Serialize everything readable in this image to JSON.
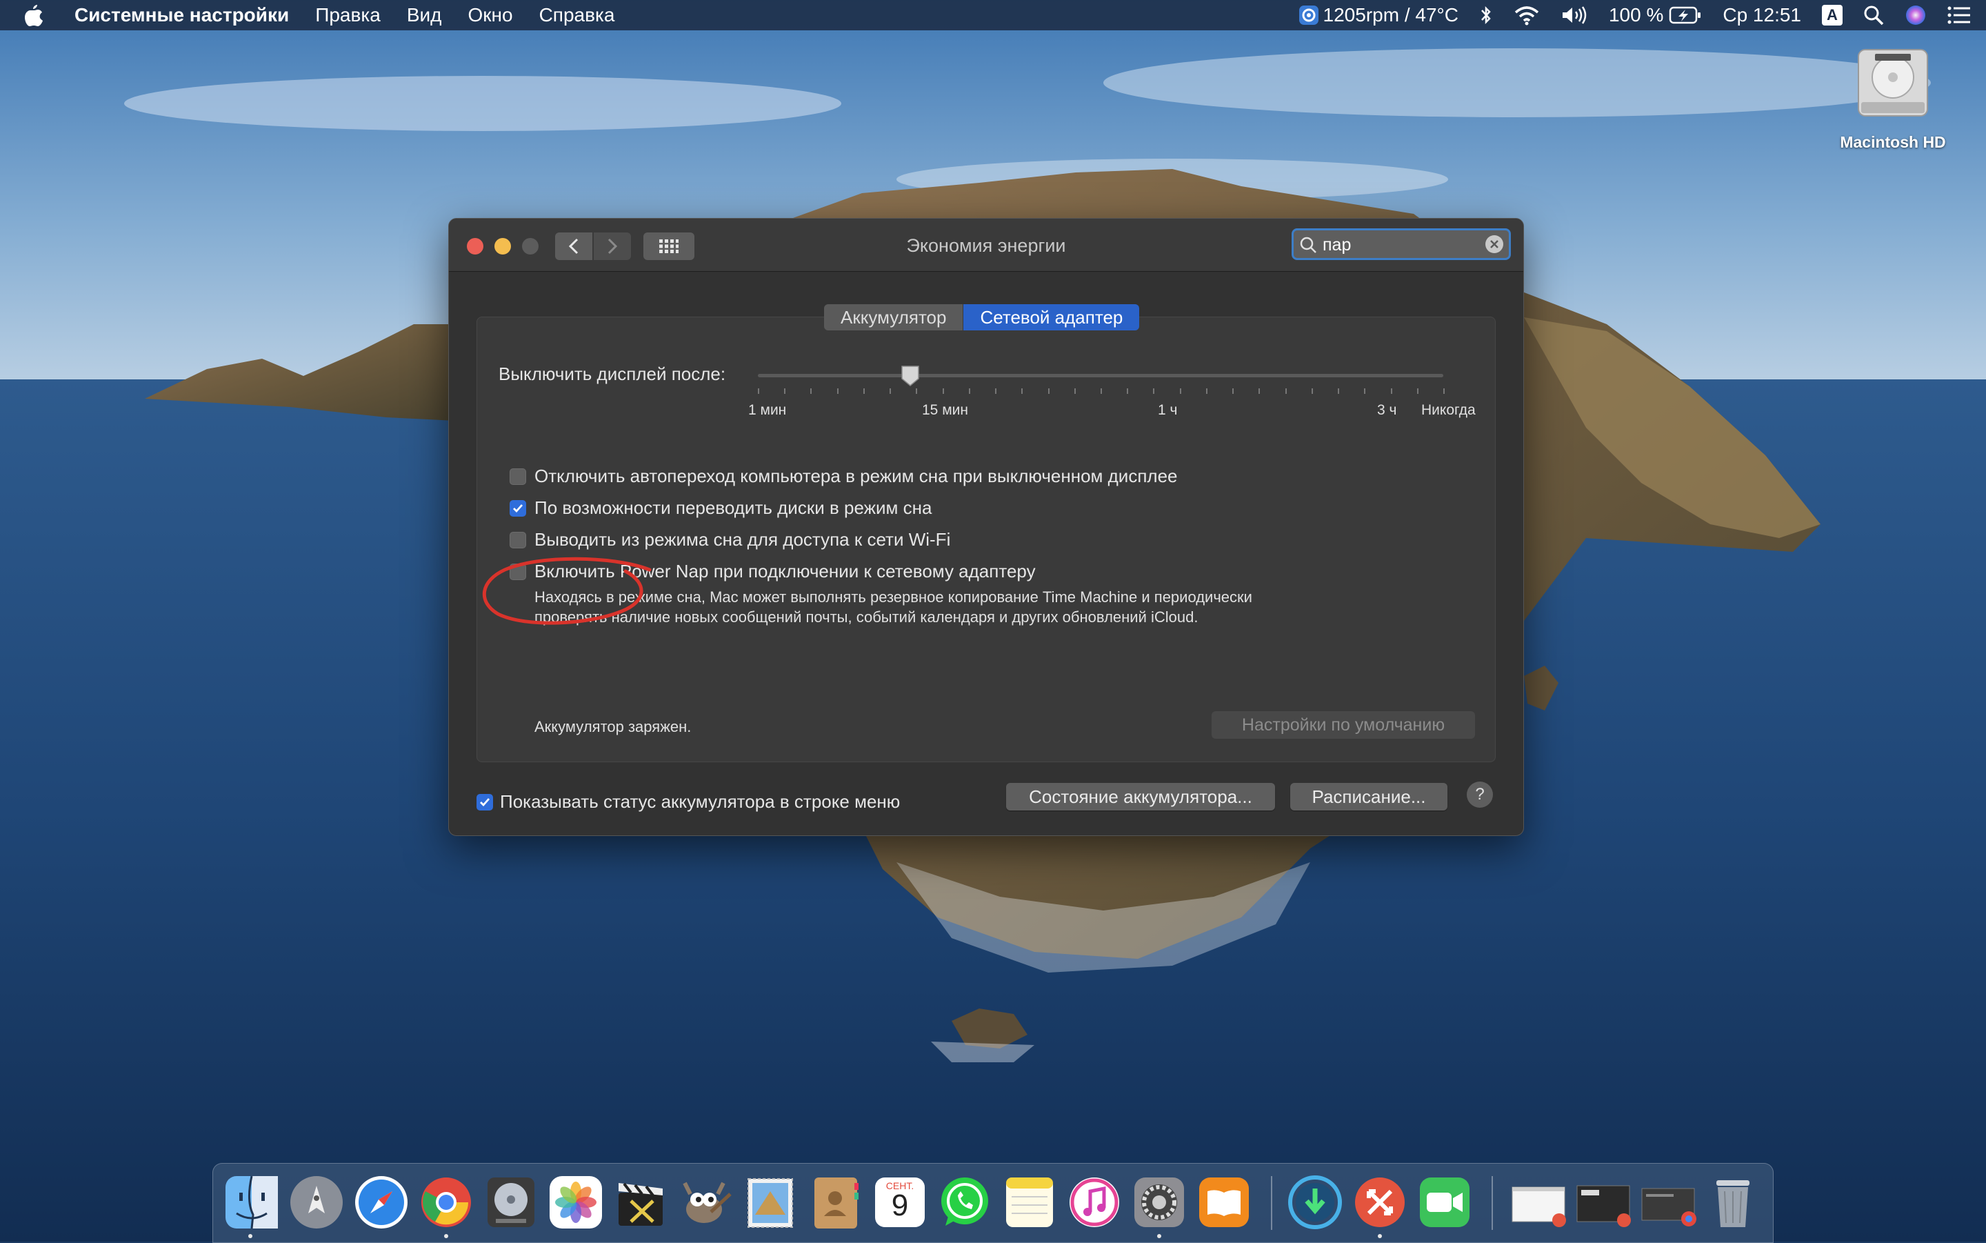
{
  "menubar": {
    "app_name": "Системные настройки",
    "items": [
      "Правка",
      "Вид",
      "Окно",
      "Справка"
    ],
    "fan_status": "1205rpm / 47°C",
    "battery_percent": "100 %",
    "clock": "Ср 12:51",
    "input_source": "A"
  },
  "desktop": {
    "disk_label": "Macintosh HD"
  },
  "window": {
    "title": "Экономия энергии",
    "search": {
      "value": "пар"
    },
    "tabs": [
      {
        "label": "Аккумулятор",
        "selected": false
      },
      {
        "label": "Сетевой адаптер",
        "selected": true
      }
    ],
    "display_off": {
      "label": "Выключить дисплей после:",
      "value": "10 мин",
      "ticks": [
        "1 мин",
        "15 мин",
        "1 ч",
        "3 ч",
        "Никогда"
      ]
    },
    "options": [
      {
        "label": "Отключить автопереход компьютера в режим сна при выключенном дисплее",
        "checked": false
      },
      {
        "label": "По возможности переводить диски в режим сна",
        "checked": true
      },
      {
        "label": "Выводить из режима сна для доступа к сети Wi-Fi",
        "checked": false
      },
      {
        "label": "Включить Power Nap при подключении к сетевому адаптеру",
        "checked": false
      }
    ],
    "power_nap_desc_1": "Находясь в режиме сна, Mac может выполнять резервное копирование Time Machine и периодически",
    "power_nap_desc_2": "проверять наличие новых сообщений почты, событий календаря и других обновлений iCloud.",
    "battery_status": "Аккумулятор заряжен.",
    "defaults_button": "Настройки по умолчанию",
    "show_status_label": "Показывать статус аккумулятора в строке меню",
    "show_status_checked": true,
    "battery_state_button": "Состояние аккумулятора...",
    "schedule_button": "Расписание...",
    "help_button": "?"
  },
  "calendar_icon": {
    "month": "СЕНТ.",
    "day": "9"
  },
  "colors": {
    "accent": "#2f6ddb",
    "close": "#ec5f56",
    "minimize": "#f4bd4f",
    "annotation": "#d9332b"
  }
}
